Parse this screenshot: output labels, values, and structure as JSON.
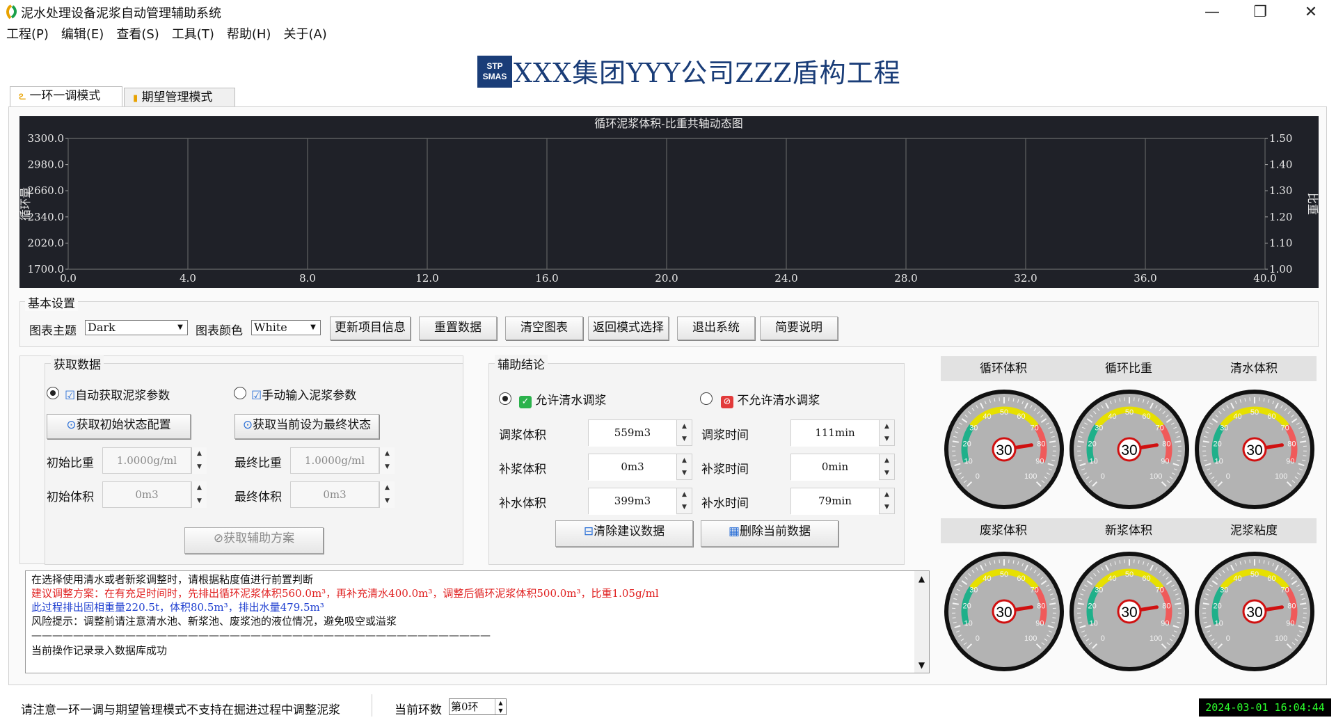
{
  "window": {
    "title": "泥水处理设备泥浆自动管理辅助系统",
    "controls": {
      "minimize": "—",
      "maximize": "❐",
      "close": "✕"
    }
  },
  "menu": [
    "工程(P)",
    "编辑(E)",
    "查看(S)",
    "工具(T)",
    "帮助(H)",
    "关于(A)"
  ],
  "header": {
    "logo_line1": "STP",
    "logo_line2": "SMAS",
    "project_title": "XXX集团YYY公司ZZZ盾构工程"
  },
  "tabs": [
    {
      "label": "一环一调模式",
      "active": true
    },
    {
      "label": "期望管理模式",
      "active": false
    }
  ],
  "chart_data": {
    "type": "line",
    "title": "循环泥浆体积-比重共轴动态图",
    "ylabel_left": "循环量",
    "ylabel_right": "比重",
    "x_ticks": [
      "0.0",
      "4.0",
      "8.0",
      "12.0",
      "16.0",
      "20.0",
      "24.0",
      "28.0",
      "32.0",
      "36.0",
      "40.0"
    ],
    "y_left_ticks": [
      "3300.0",
      "2980.0",
      "2660.0",
      "2340.0",
      "2020.0",
      "1700.0"
    ],
    "y_right_ticks": [
      "1.50",
      "1.40",
      "1.30",
      "1.20",
      "1.10",
      "1.00"
    ],
    "xlim": [
      0,
      40
    ],
    "ylim_left": [
      1700,
      3300
    ],
    "ylim_right": [
      1.0,
      1.5
    ],
    "grid": true,
    "series": []
  },
  "basic_settings": {
    "group_label": "基本设置",
    "chart_theme_label": "图表主题",
    "chart_theme_value": "Dark",
    "chart_color_label": "图表颜色",
    "chart_color_value": "White",
    "buttons": [
      "更新项目信息",
      "重置数据",
      "清空图表",
      "返回模式选择",
      "退出系统",
      "简要说明"
    ]
  },
  "acquire": {
    "group_label": "获取数据",
    "radio_auto": "自动获取泥浆参数",
    "radio_manual": "手动输入泥浆参数",
    "btn_init_state": "获取初始状态配置",
    "btn_final_state": "获取当前设为最终状态",
    "init_density_label": "初始比重",
    "init_density_value": "1.0000g/ml",
    "final_density_label": "最终比重",
    "final_density_value": "1.0000g/ml",
    "init_volume_label": "初始体积",
    "init_volume_value": "0m3",
    "final_volume_label": "最终体积",
    "final_volume_value": "0m3",
    "btn_get_plan": "获取辅助方案"
  },
  "conclusion": {
    "group_label": "辅助结论",
    "radio_allow": "允许清水调浆",
    "radio_disallow": "不允许清水调浆",
    "adjust_volume_label": "调浆体积",
    "adjust_volume_value": "559m3",
    "adjust_time_label": "调浆时间",
    "adjust_time_value": "111min",
    "supp_slurry_volume_label": "补浆体积",
    "supp_slurry_volume_value": "0m3",
    "supp_slurry_time_label": "补浆时间",
    "supp_slurry_time_value": "0min",
    "supp_water_volume_label": "补水体积",
    "supp_water_volume_value": "399m3",
    "supp_water_time_label": "补水时间",
    "supp_water_time_value": "79min",
    "btn_clear_suggest": "清除建议数据",
    "btn_delete_current": "删除当前数据"
  },
  "log": {
    "lines": [
      {
        "text": "在选择使用清水或者新浆调整时，请根据粘度值进行前置判断",
        "color": "#111111"
      },
      {
        "text": "建议调整方案：在有充足时间时，先排出循环泥浆体积560.0m³，再补充清水400.0m³，调整后循环泥浆体积500.0m³，比重1.05g/ml",
        "color": "#e02020"
      },
      {
        "text": "此过程排出固相重量220.5t，体积80.5m³，排出水量479.5m³",
        "color": "#1f3fd0"
      },
      {
        "text": "风险提示：调整前请注意清水池、新浆池、废浆池的液位情况，避免吸空或溢浆",
        "color": "#111111"
      },
      {
        "text": "————————————————————————————————————————————",
        "color": "#111111"
      },
      {
        "text": "当前操作记录录入数据库成功",
        "color": "#111111"
      }
    ]
  },
  "gauges": [
    {
      "label": "循环体积",
      "value": 30
    },
    {
      "label": "循环比重",
      "value": 30
    },
    {
      "label": "清水体积",
      "value": 30
    },
    {
      "label": "废浆体积",
      "value": 30
    },
    {
      "label": "新浆体积",
      "value": 30
    },
    {
      "label": "泥浆粘度",
      "value": 30
    }
  ],
  "gauge_scale": [
    "0",
    "10",
    "20",
    "30",
    "40",
    "50",
    "60",
    "70",
    "80",
    "90",
    "100"
  ],
  "status": {
    "notice": "请注意一环一调与期望管理模式不支持在掘进过程中调整泥浆",
    "ring_label": "当前环数",
    "ring_value": "第0环",
    "datetime": "2024-03-01 16:04:44"
  },
  "colors": {
    "chart_bg": "#1f2128",
    "brand": "#1a3d78",
    "gauge_green": "#1fb08a",
    "gauge_yellow": "#e7e000",
    "gauge_red": "#f05a5a",
    "needle": "#d01010"
  }
}
